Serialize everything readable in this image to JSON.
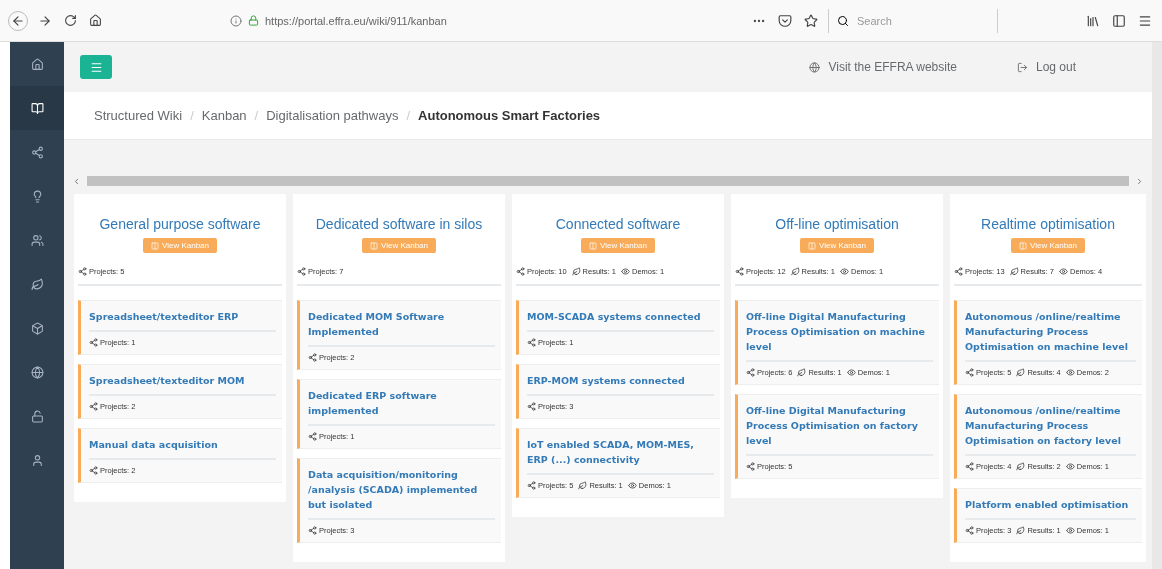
{
  "browser": {
    "url": "https://portal.effra.eu/wiki/911/kanban",
    "search": {
      "placeholder": "Search"
    }
  },
  "sidebar": {
    "items": [
      {
        "kind": "home",
        "selected": false
      },
      {
        "kind": "book",
        "selected": true
      },
      {
        "kind": "share",
        "selected": false
      },
      {
        "kind": "bulb",
        "selected": false
      },
      {
        "kind": "users",
        "selected": false
      },
      {
        "kind": "leaf",
        "selected": false
      },
      {
        "kind": "cube",
        "selected": false
      },
      {
        "kind": "globe",
        "selected": false
      },
      {
        "kind": "unlock",
        "selected": false
      },
      {
        "kind": "user",
        "selected": false
      }
    ]
  },
  "header": {
    "links": [
      {
        "kind": "globe",
        "label": "Visit the EFFRA website"
      },
      {
        "kind": "logout",
        "label": "Log out"
      }
    ]
  },
  "breadcrumb": {
    "separator": "/",
    "items": [
      {
        "label": "Structured Wiki",
        "current": false
      },
      {
        "label": "Kanban",
        "current": false
      },
      {
        "label": "Digitalisation pathways",
        "current": false
      },
      {
        "label": "Autonomous Smart Factories",
        "current": true
      }
    ]
  },
  "columns": [
    {
      "title": "General purpose software",
      "button": "View Kanban",
      "stats": [
        {
          "kind": "projects",
          "text": "Projects: 5"
        }
      ],
      "cards": [
        {
          "title": "Spreadsheet/texteditor ERP",
          "stats": [
            {
              "kind": "projects",
              "text": "Projects: 1"
            }
          ]
        },
        {
          "title": "Spreadsheet/texteditor MOM",
          "stats": [
            {
              "kind": "projects",
              "text": "Projects: 2"
            }
          ]
        },
        {
          "title": "Manual data acquisition",
          "stats": [
            {
              "kind": "projects",
              "text": "Projects: 2"
            }
          ]
        }
      ]
    },
    {
      "title": "Dedicated software in silos",
      "button": "View Kanban",
      "stats": [
        {
          "kind": "projects",
          "text": "Projects: 7"
        }
      ],
      "cards": [
        {
          "title": "Dedicated MOM Software Implemented",
          "stats": [
            {
              "kind": "projects",
              "text": "Projects: 2"
            }
          ]
        },
        {
          "title": "Dedicated ERP software implemented",
          "stats": [
            {
              "kind": "projects",
              "text": "Projects: 1"
            }
          ]
        },
        {
          "title": "Data acquisition/monitoring /analysis (SCADA) implemented but isolated",
          "stats": [
            {
              "kind": "projects",
              "text": "Projects: 3"
            }
          ]
        }
      ]
    },
    {
      "title": "Connected software",
      "button": "View Kanban",
      "stats": [
        {
          "kind": "projects",
          "text": "Projects: 10"
        },
        {
          "kind": "results",
          "text": "Results: 1"
        },
        {
          "kind": "demos",
          "text": "Demos: 1"
        }
      ],
      "cards": [
        {
          "title": "MOM-SCADA systems connected",
          "stats": [
            {
              "kind": "projects",
              "text": "Projects: 1"
            }
          ]
        },
        {
          "title": "ERP-MOM systems connected",
          "stats": [
            {
              "kind": "projects",
              "text": "Projects: 3"
            }
          ]
        },
        {
          "title": "IoT enabled SCADA, MOM-MES, ERP (...) connectivity",
          "stats": [
            {
              "kind": "projects",
              "text": "Projects: 5"
            },
            {
              "kind": "results",
              "text": "Results: 1"
            },
            {
              "kind": "demos",
              "text": "Demos: 1"
            }
          ]
        }
      ]
    },
    {
      "title": "Off-line optimisation",
      "button": "View Kanban",
      "stats": [
        {
          "kind": "projects",
          "text": "Projects: 12"
        },
        {
          "kind": "results",
          "text": "Results: 1"
        },
        {
          "kind": "demos",
          "text": "Demos: 1"
        }
      ],
      "cards": [
        {
          "title": "Off-line Digital Manufacturing Process Optimisation on machine level",
          "stats": [
            {
              "kind": "projects",
              "text": "Projects: 6"
            },
            {
              "kind": "results",
              "text": "Results: 1"
            },
            {
              "kind": "demos",
              "text": "Demos: 1"
            }
          ]
        },
        {
          "title": "Off-line Digital Manufacturing Process Optimisation on factory level",
          "stats": [
            {
              "kind": "projects",
              "text": "Projects: 5"
            }
          ]
        }
      ]
    },
    {
      "title": "Realtime optimisation",
      "button": "View Kanban",
      "stats": [
        {
          "kind": "projects",
          "text": "Projects: 13"
        },
        {
          "kind": "results",
          "text": "Results: 7"
        },
        {
          "kind": "demos",
          "text": "Demos: 4"
        }
      ],
      "cards": [
        {
          "title": "Autonomous /online/realtime Manufacturing Process Optimisation on machine level",
          "stats": [
            {
              "kind": "projects",
              "text": "Projects: 5"
            },
            {
              "kind": "results",
              "text": "Results: 4"
            },
            {
              "kind": "demos",
              "text": "Demos: 2"
            }
          ]
        },
        {
          "title": "Autonomous /online/realtime Manufacturing Process Optimisation on factory level",
          "stats": [
            {
              "kind": "projects",
              "text": "Projects: 4"
            },
            {
              "kind": "results",
              "text": "Results: 2"
            },
            {
              "kind": "demos",
              "text": "Demos: 1"
            }
          ]
        },
        {
          "title": "Platform enabled optimisation",
          "stats": [
            {
              "kind": "projects",
              "text": "Projects: 3"
            },
            {
              "kind": "results",
              "text": "Results: 1"
            },
            {
              "kind": "demos",
              "text": "Demos: 1"
            }
          ]
        }
      ]
    }
  ]
}
